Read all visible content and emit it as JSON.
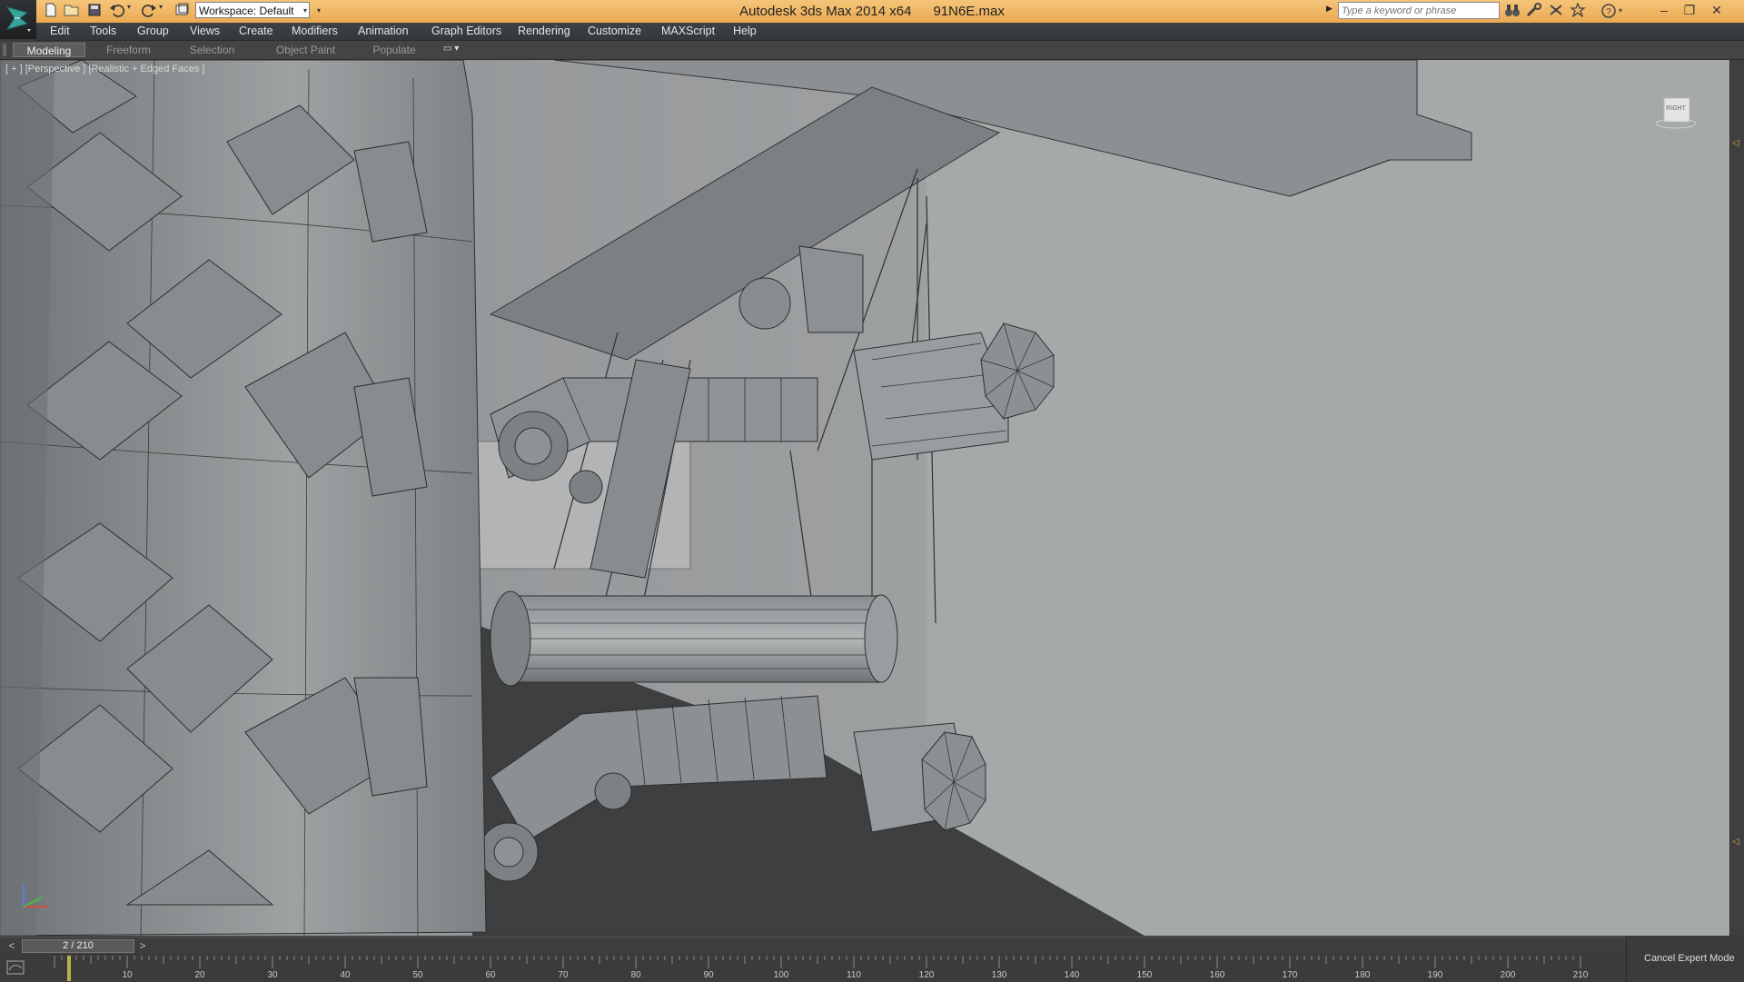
{
  "title_bar": {
    "app_name": "Autodesk 3ds Max  2014 x64",
    "file_name": "91N6E.max",
    "workspace": "Workspace: Default",
    "search_placeholder": "Type a keyword or phrase"
  },
  "menu": {
    "items": [
      "Edit",
      "Tools",
      "Group",
      "Views",
      "Create",
      "Modifiers",
      "Animation",
      "Graph Editors",
      "Rendering",
      "Customize",
      "MAXScript",
      "Help"
    ]
  },
  "ribbon": {
    "tabs": [
      "Modeling",
      "Freeform",
      "Selection",
      "Object Paint",
      "Populate"
    ],
    "active_tab": "Modeling"
  },
  "viewport": {
    "label": "[ + ] [Perspective ] [Realistic + Edged Faces ]",
    "viewcube_face": "RIGHT"
  },
  "time_slider": {
    "frame_display": "2 / 210",
    "current_frame": 2,
    "total_frames": 210,
    "prev_symbol": "<",
    "next_symbol": ">"
  },
  "track_bar": {
    "tick_labels": [
      "10",
      "20",
      "30",
      "40",
      "50",
      "60",
      "70",
      "80",
      "90",
      "100",
      "110",
      "120",
      "130",
      "140",
      "150",
      "160",
      "170",
      "180",
      "190",
      "200",
      "210"
    ]
  },
  "status": {
    "expert_mode_label": "Cancel Expert Mode"
  },
  "colors": {
    "title_bar": "#eaa952",
    "menu_bar": "#3a3d40",
    "viewport_bg": "#9b9e9f",
    "time_cursor": "#b9b24a"
  }
}
